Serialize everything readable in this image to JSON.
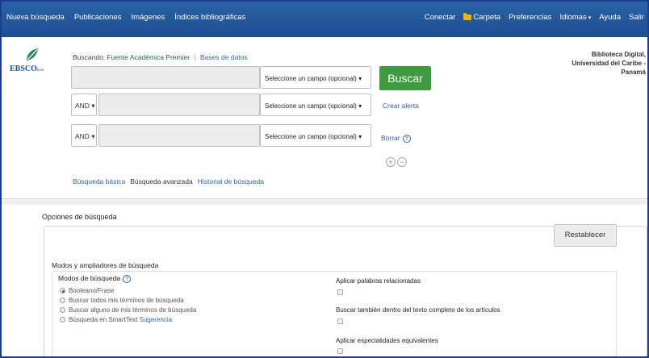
{
  "topnav": {
    "left": [
      "Nueva búsqueda",
      "Publicaciones",
      "Imágenes",
      "Índices bibliográficas"
    ],
    "connect": "Conectar",
    "folder": "Carpeta",
    "preferences": "Preferencias",
    "languages": "Idiomas",
    "help": "Ayuda",
    "exit": "Salir"
  },
  "logo": {
    "text": "EBSCO",
    "suffix": "host"
  },
  "searcher": {
    "prefix": "Buscando:",
    "database": "Fuente Académica Premier",
    "choose": "Bases de datos"
  },
  "rows": [
    {
      "operator": "",
      "field": "Seleccione un campo (opcional) ▾"
    },
    {
      "operator": "AND ▾",
      "field": "Seleccione un campo (opcional) ▾"
    },
    {
      "operator": "AND ▾",
      "field": "Seleccione un campo (opcional) ▾"
    }
  ],
  "search_button": "Buscar",
  "create_alert": "Crear alerta",
  "clear": "Borrar",
  "help_glyph": "?",
  "add_glyph": "+",
  "remove_glyph": "−",
  "search_modes": {
    "basic": "Búsqueda básica",
    "advanced": "Búsqueda avanzada",
    "history": "Historial de búsqueda"
  },
  "library": {
    "line1": "Biblioteca Digital,",
    "line2": "Universidad del Caribe -",
    "line3": "Panamá"
  },
  "options": {
    "title": "Opciones de búsqueda",
    "reset": "Restablecer",
    "modes_expanders": "Modos y ampliadores de búsqueda",
    "modes_title": "Modos de búsqueda",
    "modes": [
      {
        "label": "Booleano/Frase",
        "selected": true
      },
      {
        "label": "Buscar todos mis términos de búsqueda",
        "selected": false
      },
      {
        "label": "Buscar alguno de mis términos de búsqueda",
        "selected": false
      },
      {
        "label": "Búsqueda en SmartText",
        "selected": false
      }
    ],
    "hint_link": "Sugerencia",
    "expanders": [
      "Aplicar palabras relacionadas",
      "Buscar también dentro del texto completo de los artículos",
      "Aplicar especialidades equivalentes"
    ]
  }
}
